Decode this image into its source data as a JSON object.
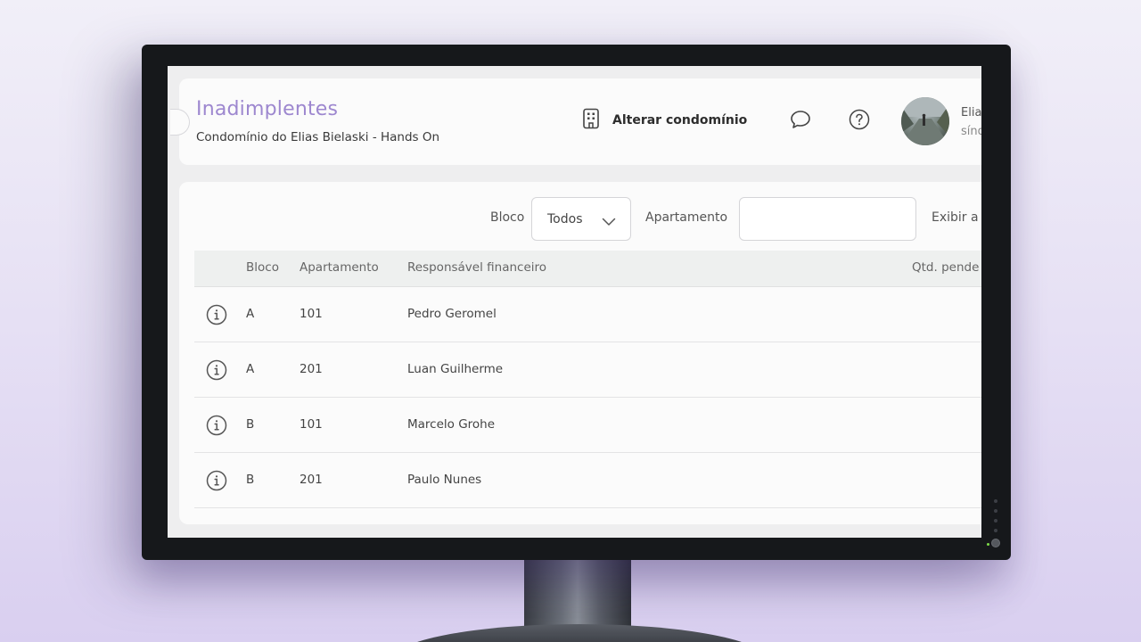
{
  "header": {
    "title": "Inadimplentes",
    "subtitle": "Condomínio do Elias Bielaski - Hands On",
    "change_condo_label": "Alterar condomínio",
    "user_name": "Elia",
    "user_role": "sínd"
  },
  "icons": {
    "building": "building-icon",
    "chat": "chat-bubble-icon",
    "help": "help-circle-icon",
    "info": "info-circle-icon",
    "chevron": "chevron-down-icon"
  },
  "filters": {
    "bloco_label": "Bloco",
    "bloco_value": "Todos",
    "apartamento_label": "Apartamento",
    "apartamento_value": "",
    "exibir_label": "Exibir a"
  },
  "table": {
    "columns": [
      "Bloco",
      "Apartamento",
      "Responsável financeiro",
      "Qtd. pende"
    ],
    "rows": [
      {
        "bloco": "A",
        "apartamento": "101",
        "responsavel": "Pedro Geromel"
      },
      {
        "bloco": "A",
        "apartamento": "201",
        "responsavel": "Luan Guilherme"
      },
      {
        "bloco": "B",
        "apartamento": "101",
        "responsavel": "Marcelo Grohe"
      },
      {
        "bloco": "B",
        "apartamento": "201",
        "responsavel": "Paulo Nunes"
      }
    ]
  },
  "colors": {
    "title": "#9d87cf",
    "background": "#eeeeef",
    "card": "#fbfbfb"
  }
}
